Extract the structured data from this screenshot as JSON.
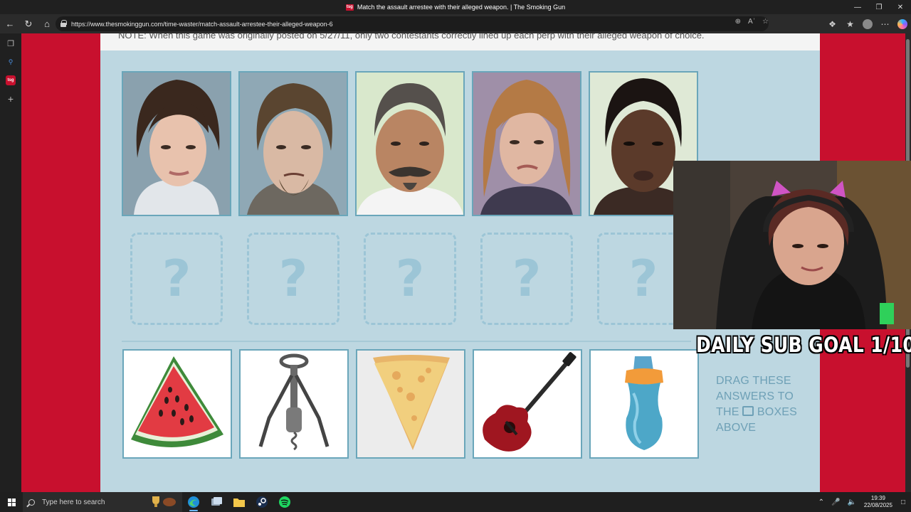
{
  "window": {
    "title": "Match the assault arrestee with their alleged weapon. | The Smoking Gun",
    "favicon_text": "tsg",
    "controls": [
      "minimize",
      "maximize",
      "close"
    ]
  },
  "browser": {
    "url": "https://www.thesmokinggun.com/time-waster/match-assault-arrestee-their-alleged-weapon-6",
    "nav_icons": [
      "back-icon",
      "reload-icon",
      "home-icon"
    ],
    "url_icons": [
      "zoom-icon",
      "read-aloud-icon",
      "favorite-star-icon"
    ],
    "toolbar_icons": [
      "extensions-icon",
      "favorites-icon",
      "profile-avatar",
      "more-icon",
      "copilot-icon"
    ]
  },
  "sidebar": {
    "items": [
      "tab-actions-icon",
      "search-icon",
      "tab-favicon",
      "new-tab-icon"
    ]
  },
  "page": {
    "note": "NOTE: When this game was originally posted on 5/27/11, only two contestants correctly lined up each perp with their alleged weapon of choice.",
    "slot_placeholder": "?",
    "mugshots": [
      {
        "label": "mugshot-1",
        "bg": "#8aa1ae",
        "skin": "#e8c2ad",
        "hair": "#3a281e"
      },
      {
        "label": "mugshot-2",
        "bg": "#8fa8b5",
        "skin": "#d9b9a4",
        "hair": "#5a4530"
      },
      {
        "label": "mugshot-3",
        "bg": "#d9e8cc",
        "skin": "#b98563",
        "hair": "#55504c"
      },
      {
        "label": "mugshot-4",
        "bg": "#9f8fa8",
        "skin": "#e0b7a2",
        "hair": "#b47a45"
      },
      {
        "label": "mugshot-5",
        "bg": "#dfe9d6",
        "skin": "#5b3a2a",
        "hair": "#1b1412"
      }
    ],
    "weapons": [
      {
        "name": "watermelon-slice"
      },
      {
        "name": "corkscrew"
      },
      {
        "name": "pizza-slice"
      },
      {
        "name": "guitar"
      },
      {
        "name": "sippy-cup"
      }
    ],
    "instructions_line1": "DRAG THESE",
    "instructions_line2": "ANSWERS TO",
    "instructions_line3a": "THE",
    "instructions_line3b": "BOXES",
    "instructions_line4": "ABOVE"
  },
  "overlay": {
    "goal_text": "DAILY SUB GOAL 1/10"
  },
  "taskbar": {
    "search_placeholder": "Type here to search",
    "apps": [
      "edge-icon",
      "task-view-icon",
      "file-explorer-icon",
      "steam-icon",
      "spotify-icon"
    ],
    "time": "19:39",
    "date": "22/08/2025"
  },
  "colors": {
    "page_red": "#c8102e",
    "game_bg": "#bdd7e1",
    "tile_border": "#6aa6ba",
    "instruction_text": "#6ea0b6"
  }
}
